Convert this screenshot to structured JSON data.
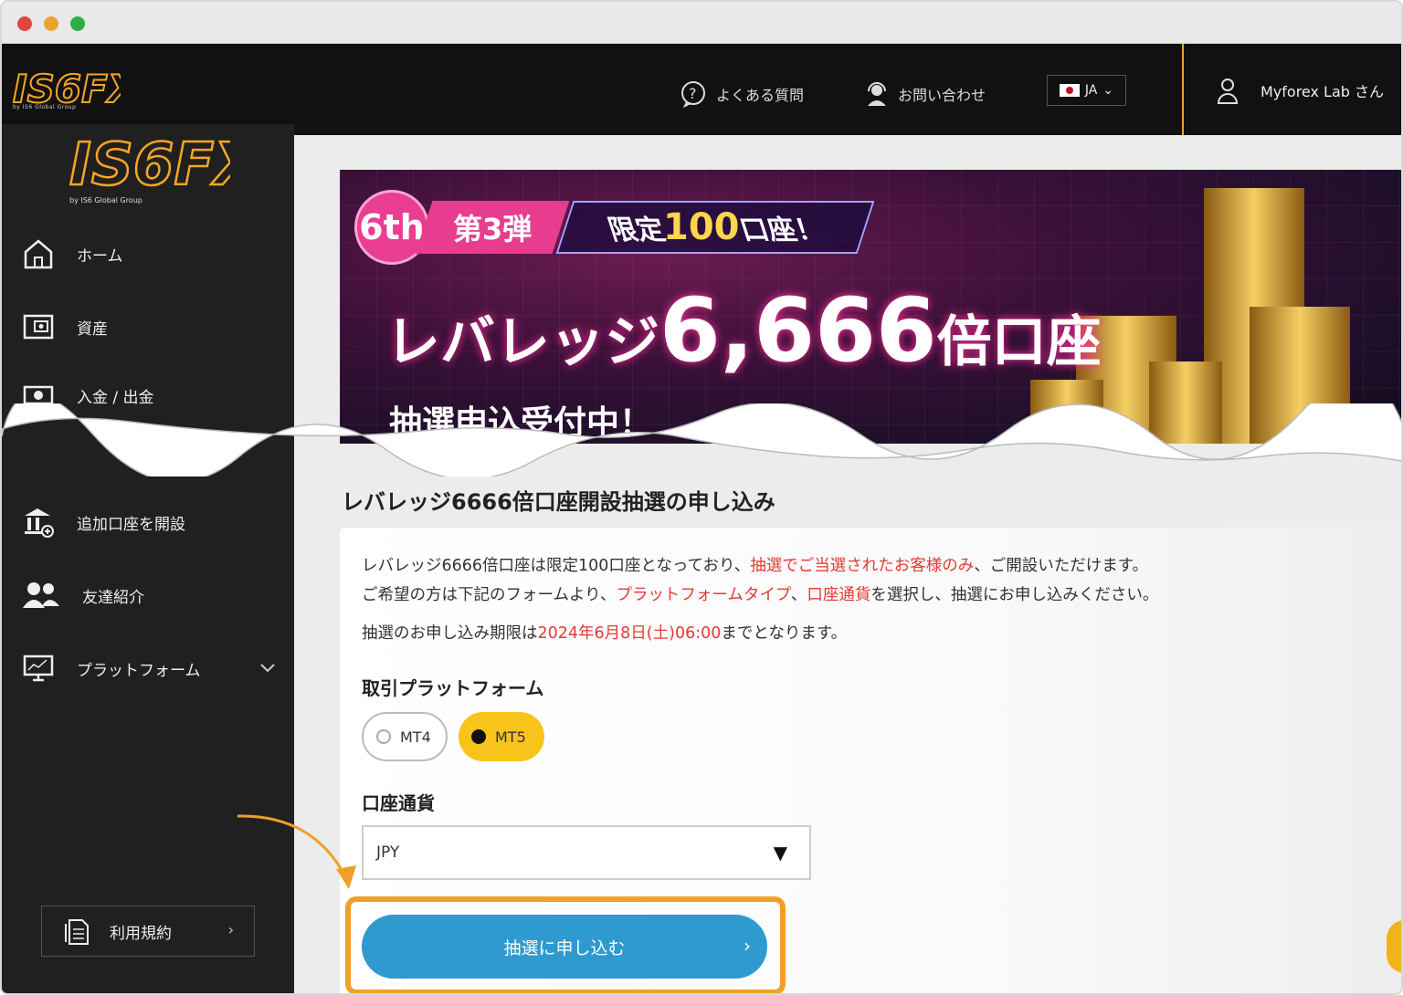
{
  "topbar": {
    "logo": "IS6FX",
    "logo_sub": "by IS6 Global Group",
    "faq_label": "よくある質問",
    "contact_label": "お問い合わせ",
    "lang": "JA",
    "user_label": "Myforex Lab さん"
  },
  "sidebar": {
    "logo": "IS6FX",
    "logo_sub": "by IS6 Global Group",
    "items": [
      {
        "label": "ホーム",
        "icon": "home-icon"
      },
      {
        "label": "資産",
        "icon": "wallet-icon"
      },
      {
        "label": "入金 / 出金",
        "icon": "cash-icon"
      },
      {
        "label": "追加口座を開設",
        "icon": "bank-add-icon"
      },
      {
        "label": "友達紹介",
        "icon": "friends-icon"
      },
      {
        "label": "プラットフォーム",
        "icon": "monitor-chart-icon"
      }
    ],
    "terms_label": "利用規約"
  },
  "banner": {
    "badge": "6th",
    "series": "第3弾",
    "limited_prefix": "限定",
    "limited_count": "100",
    "limited_suffix": "口座！",
    "headline_prefix": "レバレッジ",
    "headline_number": "6,666",
    "headline_suffix": "倍口座",
    "sub": "抽選申込受付中！"
  },
  "form": {
    "title": "レバレッジ6666倍口座開設抽選の申し込み",
    "line1_a": "レバレッジ6666倍口座は限定100口座となっており、",
    "line1_red": "抽選でご当選されたお客様のみ",
    "line1_b": "、ご開設いただけます。",
    "line2_a": "ご希望の方は下記のフォームより、",
    "line2_red1": "プラットフォームタイプ",
    "line2_sep": "、",
    "line2_red2": "口座通貨",
    "line2_b": "を選択し、抽選にお申し込みください。",
    "line3_a": "抽選のお申し込み期限は",
    "line3_red": "2024年6月8日(土)06:00",
    "line3_b": "までとなります。",
    "platform_label": "取引プラットフォーム",
    "platform_options": [
      "MT4",
      "MT5"
    ],
    "platform_selected": "MT5",
    "currency_label": "口座通貨",
    "currency_value": "JPY",
    "submit_label": "抽選に申し込む"
  },
  "colors": {
    "accent_orange": "#f0a028",
    "button_blue": "#2f9ad0",
    "selected_yellow": "#f8c41c",
    "emphasis_red": "#e53935"
  }
}
